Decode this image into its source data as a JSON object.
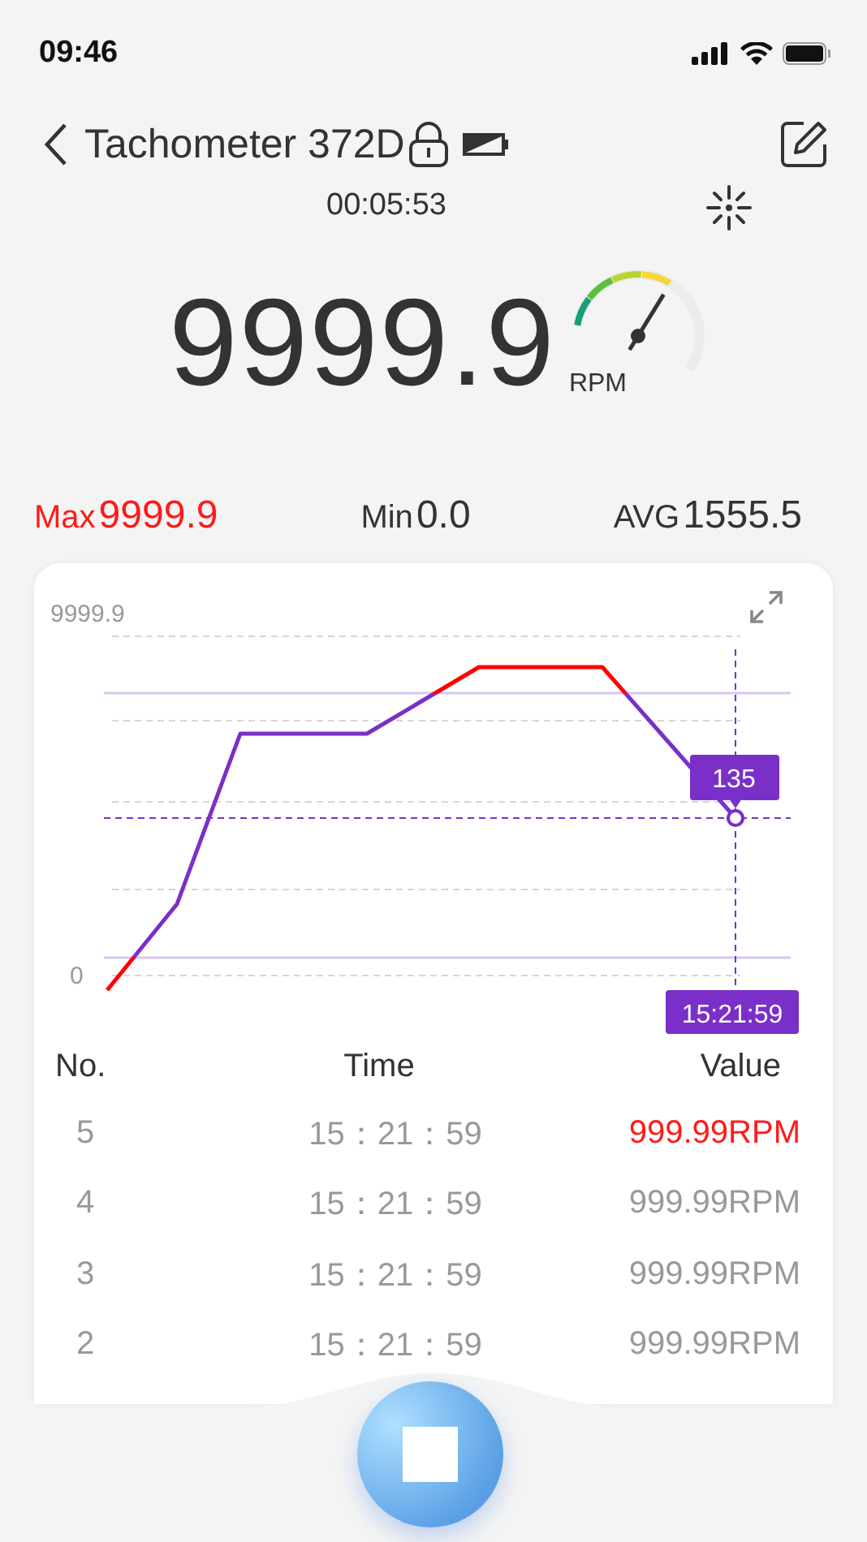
{
  "status_bar": {
    "time": "09:46"
  },
  "header": {
    "title": "Tachometer 372D",
    "locked": true,
    "elapsed": "00:05:53"
  },
  "reading": {
    "value": "9999.9",
    "unit": "RPM"
  },
  "stats": [
    {
      "kind": "max",
      "label": "Max",
      "value": "9999.9"
    },
    {
      "kind": "min",
      "label": "Min",
      "value": "0.0"
    },
    {
      "kind": "avg",
      "label": "AVG",
      "value": "1555.5"
    }
  ],
  "chart": {
    "axis_labels": [
      "9999.9",
      "0"
    ],
    "tooltip_value": "135",
    "tooltip_time": "15:21:59"
  },
  "table": {
    "columns": [
      "No.",
      "Time",
      "Value"
    ],
    "rows": [
      {
        "no": "5",
        "time": "15：21：59",
        "value": "999.99RPM",
        "alarm": true
      },
      {
        "no": "4",
        "time": "15：21：59",
        "value": "999.99RPM",
        "alarm": false
      },
      {
        "no": "3",
        "time": "15：21：59",
        "value": "999.99RPM",
        "alarm": false
      },
      {
        "no": "2",
        "time": "15：21：59",
        "value": "999.99RPM",
        "alarm": false
      }
    ]
  },
  "recording": true
}
